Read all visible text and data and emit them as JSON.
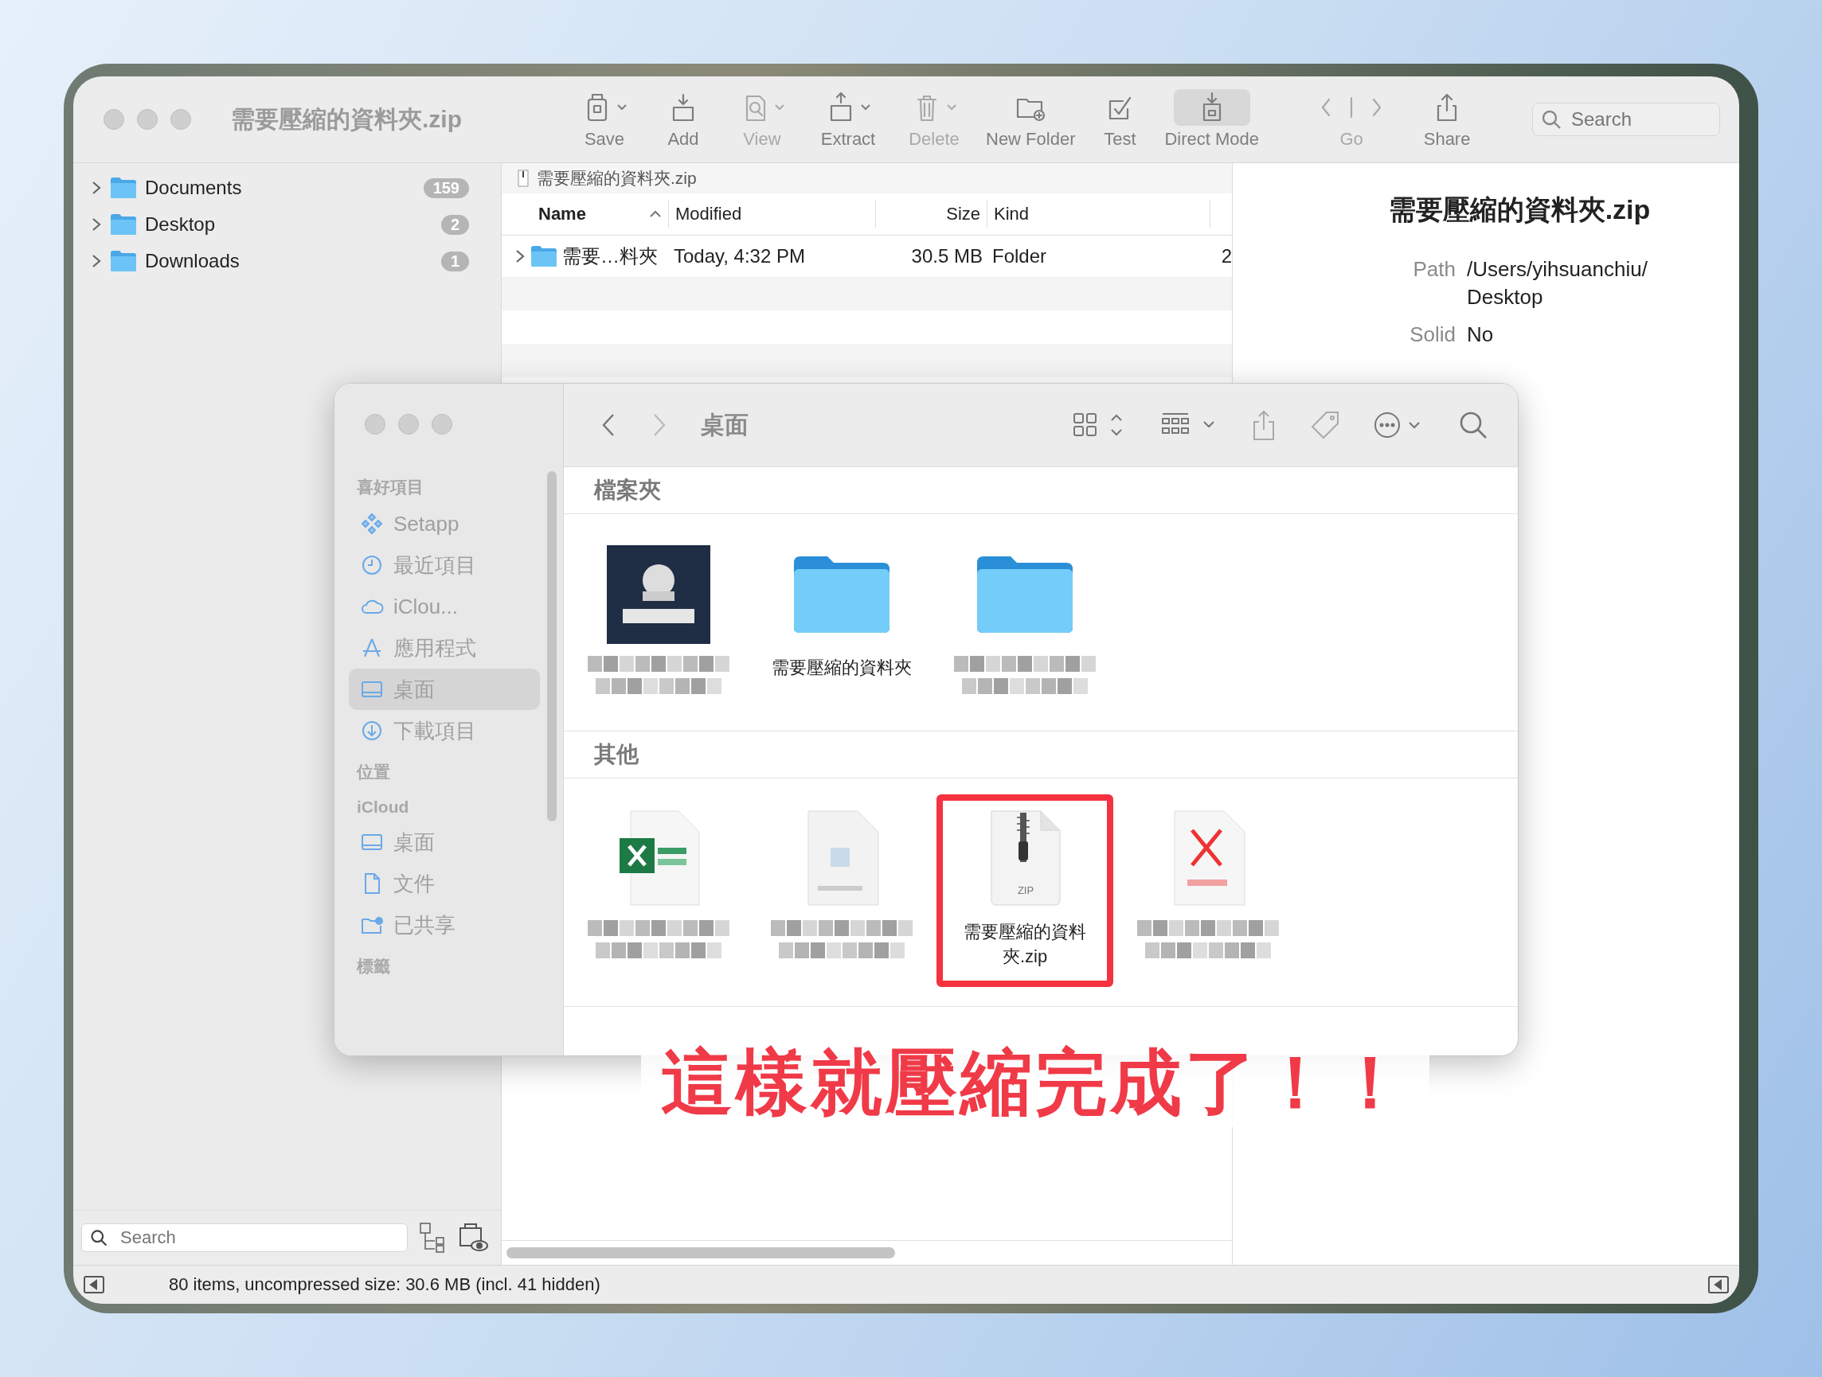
{
  "window": {
    "title": "需要壓縮的資料夾.zip"
  },
  "toolbar": [
    {
      "kind": "save",
      "label": "Save",
      "disabled": false,
      "menu": true,
      "selected": false
    },
    {
      "kind": "add",
      "label": "Add",
      "disabled": false,
      "menu": false,
      "selected": false
    },
    {
      "kind": "view",
      "label": "View",
      "disabled": true,
      "menu": true,
      "selected": false
    },
    {
      "kind": "extract",
      "label": "Extract",
      "disabled": false,
      "menu": true,
      "selected": false
    },
    {
      "kind": "delete",
      "label": "Delete",
      "disabled": true,
      "menu": true,
      "selected": false
    },
    {
      "kind": "new-folder",
      "label": "New Folder",
      "disabled": false,
      "menu": false,
      "selected": false
    },
    {
      "kind": "test",
      "label": "Test",
      "disabled": false,
      "menu": false,
      "selected": false
    },
    {
      "kind": "direct",
      "label": "Direct Mode",
      "disabled": false,
      "menu": false,
      "selected": true
    },
    {
      "kind": "go",
      "label": "Go",
      "disabled": true,
      "menu": false,
      "selected": false
    },
    {
      "kind": "share",
      "label": "Share",
      "disabled": false,
      "menu": false,
      "selected": false
    }
  ],
  "search": {
    "placeholder": "Search"
  },
  "sidebar": {
    "items": [
      {
        "name": "Documents",
        "count": "159"
      },
      {
        "name": "Desktop",
        "count": "2"
      },
      {
        "name": "Downloads",
        "count": "1"
      }
    ],
    "search_placeholder": "Search"
  },
  "path": "需要壓縮的資料夾.zip",
  "table": {
    "columns": [
      {
        "label": "Name",
        "sorted": true
      },
      {
        "label": "Modified",
        "sorted": false
      },
      {
        "label": "Size",
        "sorted": false
      },
      {
        "label": "Kind",
        "sorted": false
      }
    ],
    "rows": [
      {
        "name": "需要…料夾",
        "modified": "Today, 4:32 PM",
        "size": "30.5 MB",
        "kind": "Folder",
        "column_5": "2"
      }
    ]
  },
  "info": {
    "title": "需要壓縮的資料夾.zip",
    "fields": [
      {
        "label": "Path",
        "lines": [
          "/Users/yihsuanchiu/",
          "Desktop"
        ]
      },
      {
        "label": "Solid",
        "lines": [
          "No"
        ]
      }
    ]
  },
  "status_bar": "80 items, uncompressed size: 30.6 MB (incl. 41 hidden)",
  "finder": {
    "title": "桌面",
    "sidebar": [
      {
        "heading": "喜好項目",
        "items": [
          {
            "kind": "setapp",
            "label": "Setapp",
            "selected": false
          },
          {
            "kind": "recent",
            "label": "最近項目",
            "selected": false
          },
          {
            "kind": "cloud",
            "label": "iClou...",
            "selected": false
          },
          {
            "kind": "apps",
            "label": "應用程式",
            "selected": false
          },
          {
            "kind": "desktop",
            "label": "桌面",
            "selected": true
          },
          {
            "kind": "download",
            "label": "下載項目",
            "selected": false
          }
        ]
      },
      {
        "heading": "位置"
      },
      {
        "heading": "iCloud",
        "items": [
          {
            "kind": "desktop",
            "label": "桌面",
            "selected": false
          },
          {
            "kind": "document",
            "label": "文件",
            "selected": false
          },
          {
            "kind": "shared",
            "label": "已共享",
            "selected": false
          }
        ]
      },
      {
        "heading": "標籤"
      }
    ],
    "groups": [
      {
        "heading": "檔案夾",
        "files": [
          {
            "kind": "app-thumb",
            "blurred": true,
            "highlighted": false
          },
          {
            "kind": "folder",
            "label": "需要壓縮的資料夾",
            "blurred": false,
            "highlighted": false
          },
          {
            "kind": "folder",
            "blurred": true,
            "highlighted": false
          }
        ]
      },
      {
        "heading": "其他",
        "files": [
          {
            "kind": "spreadsheet",
            "blurred": true,
            "highlighted": false
          },
          {
            "kind": "document",
            "blurred": true,
            "highlighted": false
          },
          {
            "kind": "zip",
            "label": "需要壓縮的資料夾.zip",
            "icon_text": "ZIP",
            "blurred": false,
            "highlighted": true
          },
          {
            "kind": "pdf",
            "blurred": true,
            "highlighted": false
          }
        ]
      }
    ]
  },
  "caption": "這樣就壓縮完成了！！"
}
